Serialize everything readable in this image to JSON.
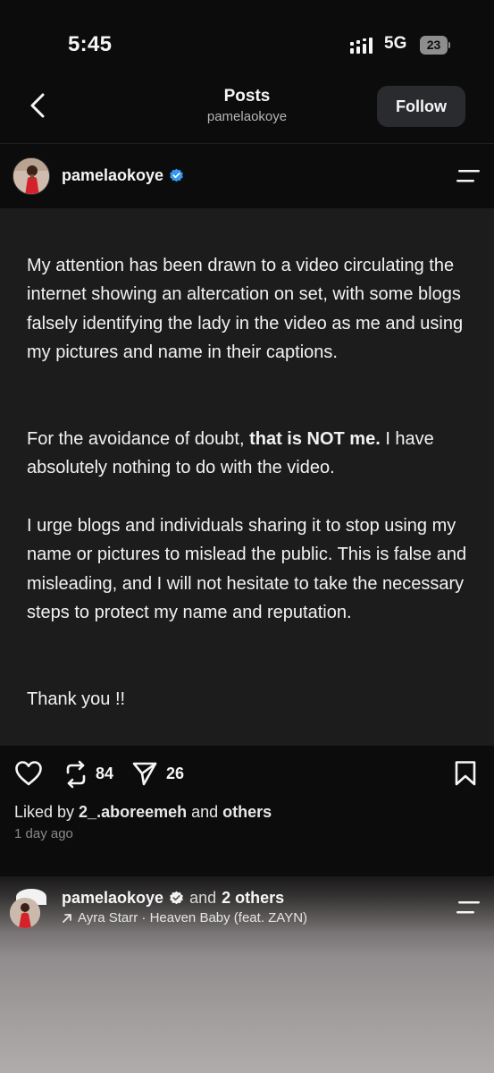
{
  "status_bar": {
    "time": "5:45",
    "network": "5G",
    "battery": "23"
  },
  "header": {
    "title": "Posts",
    "subtitle": "pamelaokoye",
    "follow_label": "Follow"
  },
  "post": {
    "username": "pamelaokoye",
    "paragraphs": {
      "p1": "My attention has been drawn to a video circulating the internet showing an altercation on set, with some blogs falsely identifying the lady in the video as me and using my pictures and name in their captions.",
      "p2_before": "For the avoidance of doubt, ",
      "p2_bold": "that is NOT me.",
      "p2_after": " I have absolutely nothing to do with the video.",
      "p3": "I urge blogs and individuals sharing it to stop using my name or pictures to mislead the public. This is false and misleading, and I will not hesitate to take the necessary steps to protect my name and reputation.",
      "p4": "Thank you !!"
    },
    "repost_count": "84",
    "share_count": "26",
    "liked_by_prefix": "Liked by ",
    "liked_by_user": "2_.aboreemeh",
    "liked_by_and": " and ",
    "liked_by_others": "others",
    "time_ago": "1 day ago"
  },
  "next_post": {
    "username": "pamelaokoye",
    "and_label": "and",
    "others_label": "2 others",
    "music": "Ayra Starr · Heaven Baby (feat. ZAYN)"
  },
  "colors": {
    "background": "#0c0c0c",
    "card": "#1c1c1d",
    "verified": "#3797f0",
    "follow_button": "#2a2b2e"
  },
  "icons": [
    "back-arrow-icon",
    "verified-badge-icon",
    "menu-icon",
    "heart-icon",
    "repost-icon",
    "share-icon",
    "bookmark-icon",
    "signal-icon",
    "battery-icon",
    "music-arrow-icon"
  ]
}
